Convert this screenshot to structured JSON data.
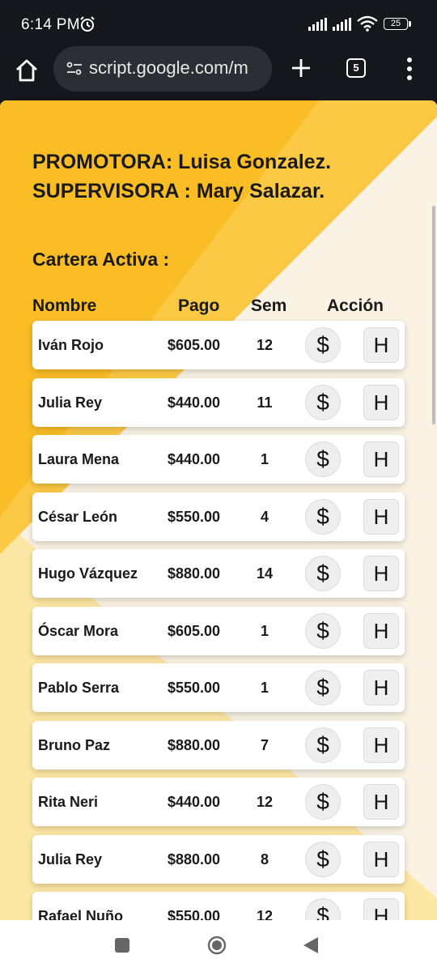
{
  "status_bar": {
    "time": "6:14 PM",
    "battery": "25"
  },
  "browser": {
    "url": "script.google.com/m",
    "tab_count": "5"
  },
  "header": {
    "promotora": "PROMOTORA: Luisa Gonzalez.",
    "supervisora": "SUPERVISORA : Mary Salazar.",
    "cartera": "Cartera Activa :"
  },
  "columns": {
    "nombre": "Nombre",
    "pago": "Pago",
    "sem": "Sem",
    "accion": "Acción"
  },
  "rows": [
    {
      "name": "Iván Rojo",
      "pay": "$605.00",
      "sem": "12",
      "pay_btn": "$",
      "h_btn": "H"
    },
    {
      "name": "Julia Rey",
      "pay": "$440.00",
      "sem": "11",
      "pay_btn": "$",
      "h_btn": "H"
    },
    {
      "name": "Laura Mena",
      "pay": "$440.00",
      "sem": "1",
      "pay_btn": "$",
      "h_btn": "H"
    },
    {
      "name": "César León",
      "pay": "$550.00",
      "sem": "4",
      "pay_btn": "$",
      "h_btn": "H"
    },
    {
      "name": "Hugo Vázquez",
      "pay": "$880.00",
      "sem": "14",
      "pay_btn": "$",
      "h_btn": "H"
    },
    {
      "name": "Óscar Mora",
      "pay": "$605.00",
      "sem": "1",
      "pay_btn": "$",
      "h_btn": "H"
    },
    {
      "name": "Pablo Serra",
      "pay": "$550.00",
      "sem": "1",
      "pay_btn": "$",
      "h_btn": "H"
    },
    {
      "name": "Bruno Paz",
      "pay": "$880.00",
      "sem": "7",
      "pay_btn": "$",
      "h_btn": "H"
    },
    {
      "name": "Rita Neri",
      "pay": "$440.00",
      "sem": "12",
      "pay_btn": "$",
      "h_btn": "H"
    },
    {
      "name": "Julia Rey",
      "pay": "$880.00",
      "sem": "8",
      "pay_btn": "$",
      "h_btn": "H"
    },
    {
      "name": "Rafael Nuño",
      "pay": "$550.00",
      "sem": "12",
      "pay_btn": "$",
      "h_btn": "H"
    }
  ],
  "colors": {
    "accent_yellow": "#fbbd25",
    "light_yellow": "#fde7a4",
    "cream": "#faf3e4"
  }
}
